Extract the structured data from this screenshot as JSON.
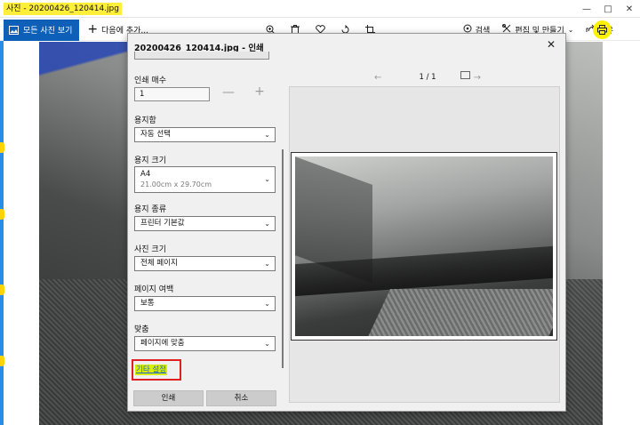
{
  "window": {
    "title": "사진 - 20200426_120414.jpg"
  },
  "toolbar": {
    "all_photos": "모든 사진 보기",
    "add_to": "다음에 추가...",
    "search": "검색",
    "edit_create": "편집 및 만들기",
    "share": "공유"
  },
  "dialog": {
    "title": "20200426_120414.jpg - 인쇄",
    "copies_label": "인쇄 매수",
    "copies_value": "1",
    "stepper_minus": "—",
    "stepper_plus": "+",
    "paper_tray_label": "용지함",
    "paper_tray_value": "자동 선택",
    "paper_size_label": "용지 크기",
    "paper_size_value": "A4",
    "paper_size_dims": "21.00cm x 29.70cm",
    "paper_type_label": "용지 종류",
    "paper_type_value": "프린터 기본값",
    "photo_size_label": "사진 크기",
    "photo_size_value": "전체 페이지",
    "margins_label": "페이지 여백",
    "margins_value": "보통",
    "fit_label": "맞춤",
    "fit_value": "페이지에 맞춤",
    "more_settings": "기타 설정",
    "print_button": "인쇄",
    "cancel_button": "취소",
    "page_indicator": "1 / 1"
  },
  "colors": {
    "accent": "#0d5fb8",
    "highlight": "#fff200",
    "link": "#2563c9",
    "callout_border": "#e02020"
  }
}
